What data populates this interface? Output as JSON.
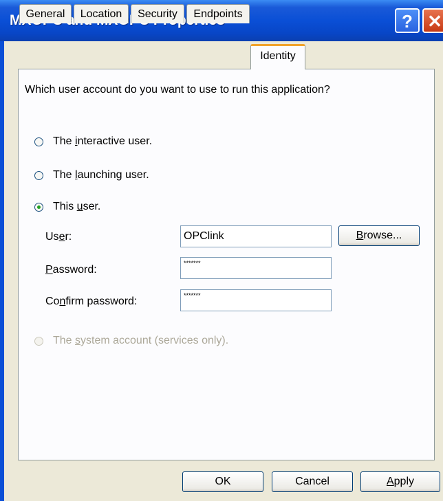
{
  "window": {
    "title": "MXOPC and MXOPC Properties",
    "help_glyph": "?",
    "close_glyph": "✕"
  },
  "tabs": [
    {
      "label": "General"
    },
    {
      "label": "Location"
    },
    {
      "label": "Security"
    },
    {
      "label": "Endpoints"
    },
    {
      "label": "Identity",
      "active": true
    }
  ],
  "identity": {
    "question": "Which user account do you want to use to run this application?",
    "options": {
      "interactive": {
        "pre": "The ",
        "accel": "i",
        "post": "nteractive user."
      },
      "launching": {
        "pre": "The ",
        "accel": "l",
        "post": "aunching user."
      },
      "this_user": {
        "pre": "This ",
        "accel": "u",
        "post": "ser.",
        "selected": true
      },
      "system": {
        "pre": "The ",
        "accel": "s",
        "post": "ystem account (services only).",
        "disabled": true
      }
    },
    "user_label": {
      "pre": "Us",
      "accel": "e",
      "post": "r:"
    },
    "user_value": "OPClink",
    "password_label": {
      "pre": "",
      "accel": "P",
      "post": "assword:"
    },
    "password_value": "*******",
    "confirm_label": {
      "pre": "Co",
      "accel": "n",
      "post": "firm password:"
    },
    "confirm_value": "*******",
    "browse_button": {
      "pre": "",
      "accel": "B",
      "post": "rowse..."
    }
  },
  "footer": {
    "ok_label": "OK",
    "cancel_label": "Cancel",
    "apply": {
      "pre": "",
      "accel": "A",
      "post": "pply"
    }
  }
}
